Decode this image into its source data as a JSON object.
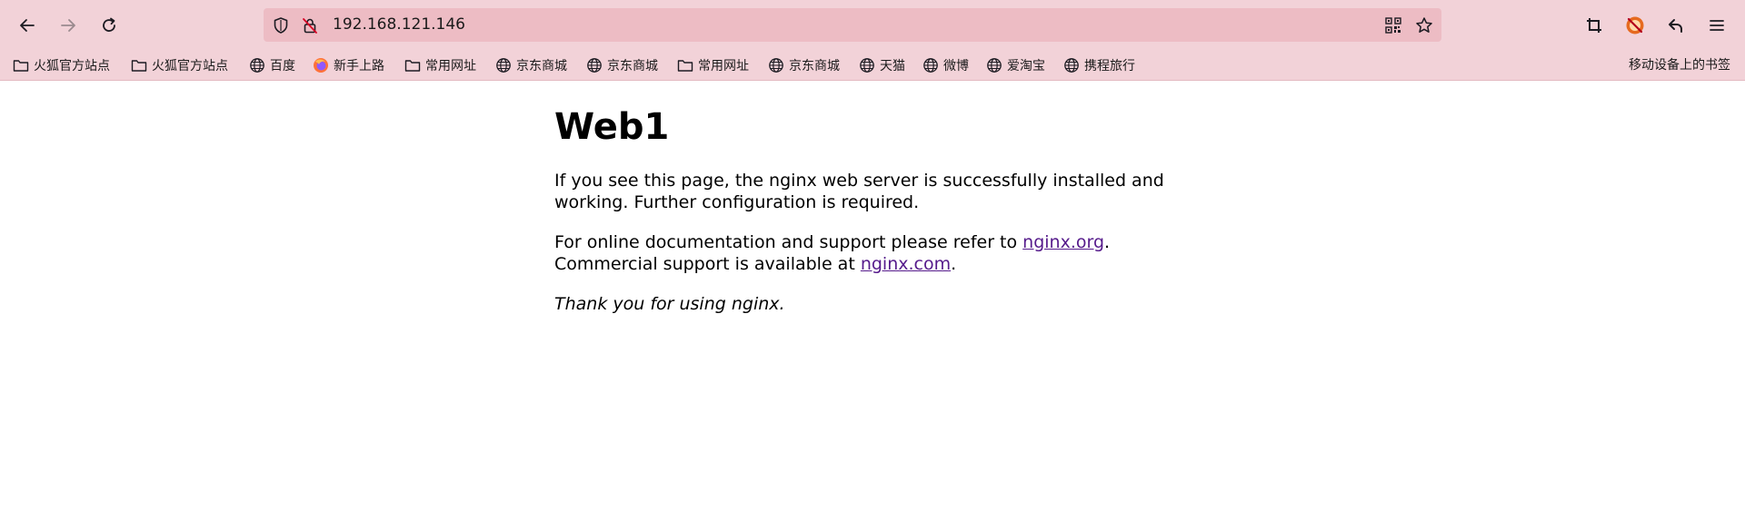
{
  "browser": {
    "url": "192.168.121.146",
    "bookmarks": [
      {
        "label": "火狐官方站点",
        "icon": "folder-icon"
      },
      {
        "label": "火狐官方站点",
        "icon": "folder-icon"
      },
      {
        "label": "百度",
        "icon": "globe-icon"
      },
      {
        "label": "新手上路",
        "icon": "firefox-icon"
      },
      {
        "label": "常用网址",
        "icon": "folder-icon"
      },
      {
        "label": "京东商城",
        "icon": "globe-icon"
      },
      {
        "label": "京东商城",
        "icon": "globe-icon"
      },
      {
        "label": "常用网址",
        "icon": "folder-icon"
      },
      {
        "label": "京东商城",
        "icon": "globe-icon"
      },
      {
        "label": "天猫",
        "icon": "globe-icon"
      },
      {
        "label": "微博",
        "icon": "globe-icon"
      },
      {
        "label": "爱淘宝",
        "icon": "globe-icon"
      },
      {
        "label": "携程旅行",
        "icon": "globe-icon"
      }
    ],
    "mobile_bookmarks": "移动设备上的书签",
    "accent_color": "#f2d2d8",
    "urlbar_color": "#edbcc4"
  },
  "page": {
    "title": "Web1",
    "para1": "If you see this page, the nginx web server is successfully installed and working. Further configuration is required.",
    "para2_prefix": "For online documentation and support please refer to ",
    "link1": "nginx.org",
    "para2_mid": ".",
    "para2_line2": "Commercial support is available at ",
    "link2": "nginx.com",
    "para2_end": ".",
    "thanks": "Thank you for using nginx.",
    "link_color": "#551a8b"
  }
}
